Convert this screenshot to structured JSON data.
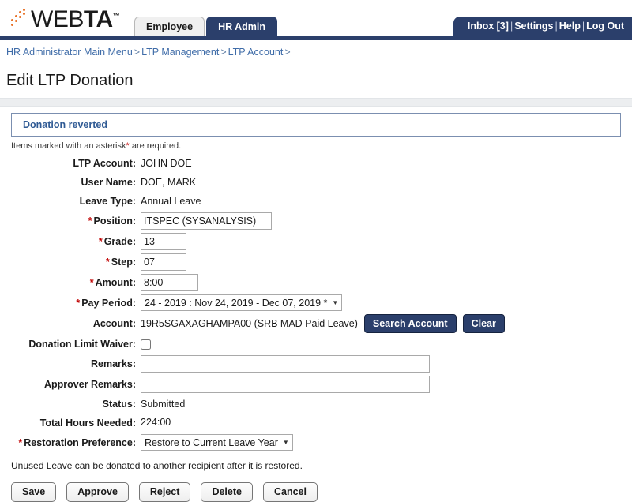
{
  "header": {
    "logo": {
      "text_light": "WEB",
      "text_bold": "TA",
      "tm": "™",
      "dot_color": "#e8732a"
    },
    "tabs": [
      {
        "label": "Employee",
        "active": false
      },
      {
        "label": "HR Admin",
        "active": true
      }
    ],
    "links": [
      {
        "label": "Inbox [3]"
      },
      {
        "label": "Settings"
      },
      {
        "label": "Help"
      },
      {
        "label": "Log Out"
      }
    ],
    "link_separator": "|",
    "accent_navy": "#2b3f6b"
  },
  "breadcrumb": {
    "items": [
      "HR Administrator Main Menu",
      "LTP Management",
      "LTP Account"
    ],
    "separator": ">",
    "trailing_separator": ">",
    "link_color": "#3f6ca8"
  },
  "page": {
    "title": "Edit LTP Donation",
    "notice": "Donation reverted",
    "required_note_prefix": "Items marked with an asterisk",
    "required_note_asterisk": "*",
    "required_note_suffix": " are required.",
    "footnote": "Unused Leave can be donated to another recipient after it is restored."
  },
  "form": {
    "asterisk": "*",
    "ltp_account": {
      "label": "LTP Account:",
      "value": "JOHN DOE"
    },
    "user_name": {
      "label": "User Name:",
      "value": "DOE, MARK"
    },
    "leave_type": {
      "label": "Leave Type:",
      "value": "Annual Leave"
    },
    "position": {
      "label": "Position:",
      "value": "ITSPEC (SYSANALYSIS)",
      "placeholder": ""
    },
    "grade": {
      "label": "Grade:",
      "value": "13",
      "placeholder": ""
    },
    "step": {
      "label": "Step:",
      "value": "07",
      "placeholder": ""
    },
    "amount": {
      "label": "Amount:",
      "value": "8:00",
      "placeholder": ""
    },
    "pay_period": {
      "label": "Pay Period:",
      "value": "24 - 2019 : Nov 24, 2019 - Dec 07, 2019 *",
      "arrow": "▼"
    },
    "account": {
      "label": "Account:",
      "value": "19R5SGAXAGHAMPA00 (SRB MAD Paid Leave)",
      "search_button": "Search Account",
      "clear_button": "Clear"
    },
    "donation_limit_waiver": {
      "label": "Donation Limit Waiver:",
      "checked": false
    },
    "remarks": {
      "label": "Remarks:",
      "value": "",
      "placeholder": ""
    },
    "approver_remarks": {
      "label": "Approver Remarks:",
      "value": "",
      "placeholder": ""
    },
    "status": {
      "label": "Status:",
      "value": "Submitted"
    },
    "total_hours_needed": {
      "label": "Total Hours Needed:",
      "value": "224:00"
    },
    "restoration_preference": {
      "label": "Restoration Preference:",
      "value": "Restore to Current Leave Year",
      "arrow": "▼"
    }
  },
  "actions": [
    {
      "label": "Save"
    },
    {
      "label": "Approve"
    },
    {
      "label": "Reject"
    },
    {
      "label": "Delete"
    },
    {
      "label": "Cancel"
    }
  ]
}
